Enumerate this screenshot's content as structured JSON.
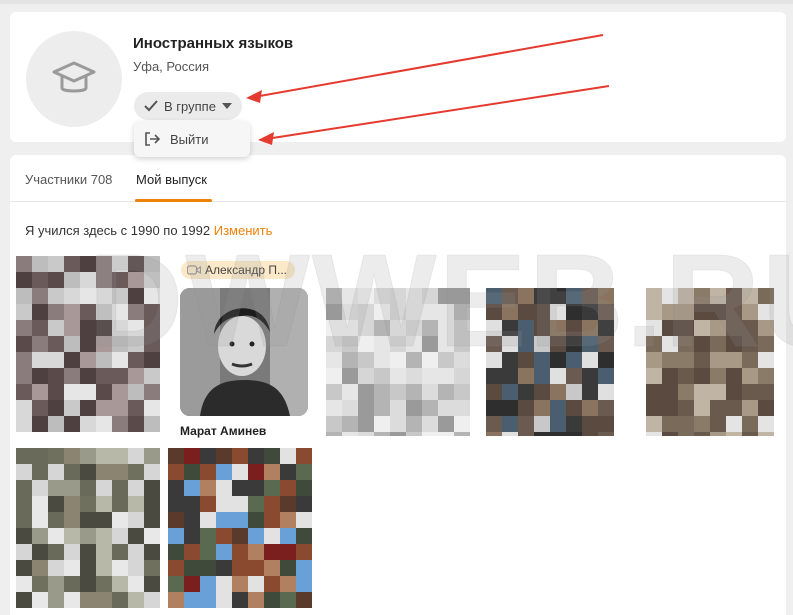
{
  "group": {
    "title": "Иностранных языков",
    "location": "Уфа, Россия",
    "avatar_icon": "graduation-cap-icon",
    "membership_button": "В группе",
    "menu": {
      "leave_label": "Выйти",
      "leave_icon": "exit-icon"
    }
  },
  "tabs": [
    {
      "label": "Участники 708",
      "active": false
    },
    {
      "label": "Мой выпуск",
      "active": true
    }
  ],
  "graduation": {
    "text": "Я учился здесь с 1990 по 1992",
    "edit_label": "Изменить"
  },
  "members": [
    {
      "name": "",
      "blurred": true
    },
    {
      "name": "Марат Аминев",
      "tag": "Александр П...",
      "blurred": false
    },
    {
      "name": "",
      "blurred": true
    },
    {
      "name": "",
      "blurred": true
    },
    {
      "name": "",
      "blurred": true
    },
    {
      "name": "",
      "blurred": true
    },
    {
      "name": "",
      "blurred": true
    }
  ],
  "watermark": "DWWEB.RU",
  "colors": {
    "accent": "#ee8208",
    "arrow": "#e53a2f",
    "tag_bg": "#fbe9c9"
  }
}
